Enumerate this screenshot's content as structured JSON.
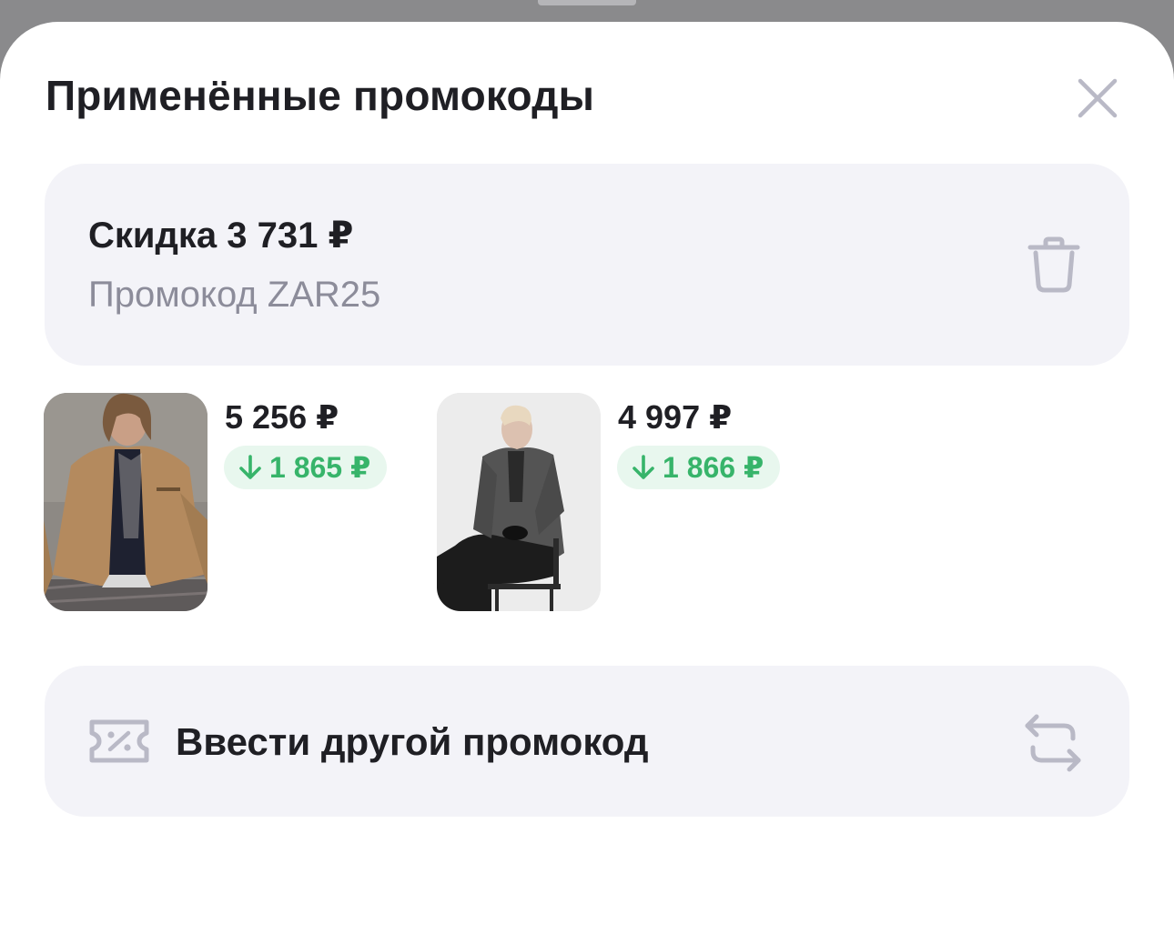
{
  "sheet": {
    "title": "Применённые промокоды"
  },
  "promo": {
    "discount": "Скидка 3 731 ₽",
    "code": "Промокод ZAR25"
  },
  "products": [
    {
      "price": "5 256 ₽",
      "discount": "1 865 ₽",
      "image": "woman-in-camel-jacket"
    },
    {
      "price": "4 997 ₽",
      "discount": "1 866 ₽",
      "image": "woman-in-grey-coat-seated"
    }
  ],
  "other_promo": {
    "label": "Ввести другой промокод"
  },
  "icons": {
    "close": "close-icon",
    "trash": "trash-icon",
    "ticket": "ticket-percent-icon",
    "swap": "swap-arrows-icon",
    "arrow_down": "arrow-down-icon"
  },
  "colors": {
    "accent_green": "#37b46a",
    "discount_badge_bg": "#e8f7ee",
    "card_bg": "#f3f3f8",
    "icon_gray": "#b9b9c6"
  }
}
